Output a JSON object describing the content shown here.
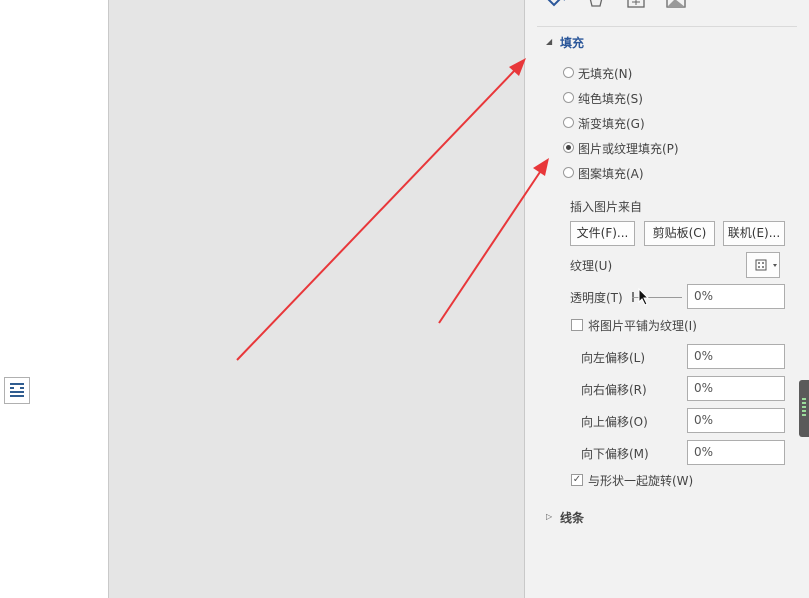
{
  "pane": {
    "fill_section": "填充",
    "line_section": "线条",
    "fill_options": [
      {
        "label": "无填充(N)",
        "selected": false
      },
      {
        "label": "纯色填充(S)",
        "selected": false
      },
      {
        "label": "渐变填充(G)",
        "selected": false
      },
      {
        "label": "图片或纹理填充(P)",
        "selected": true
      },
      {
        "label": "图案填充(A)",
        "selected": false
      }
    ],
    "insert_from": "插入图片来自",
    "buttons": {
      "file": "文件(F)...",
      "clipboard": "剪贴板(C)",
      "online": "联机(E)..."
    },
    "texture_label": "纹理(U)",
    "transparency_label": "透明度(T)",
    "transparency_value": "0%",
    "tile_label": "将图片平铺为纹理(I)",
    "tile_checked": false,
    "offsets": [
      {
        "label": "向左偏移(L)",
        "value": "0%"
      },
      {
        "label": "向右偏移(R)",
        "value": "0%"
      },
      {
        "label": "向上偏移(O)",
        "value": "0%"
      },
      {
        "label": "向下偏移(M)",
        "value": "0%"
      }
    ],
    "rotate_label": "与形状一起旋转(W)",
    "rotate_checked": true
  },
  "colors": {
    "accent": "#2b579a",
    "arrow": "#e8373a",
    "canvas": "#e5e5e5",
    "pane": "#f2f2f2"
  },
  "icons": [
    "fill-line-icon",
    "effects-icon",
    "size-properties-icon",
    "picture-icon",
    "texture-icon",
    "text-wrap-layout-icon",
    "mouse-cursor-icon"
  ]
}
